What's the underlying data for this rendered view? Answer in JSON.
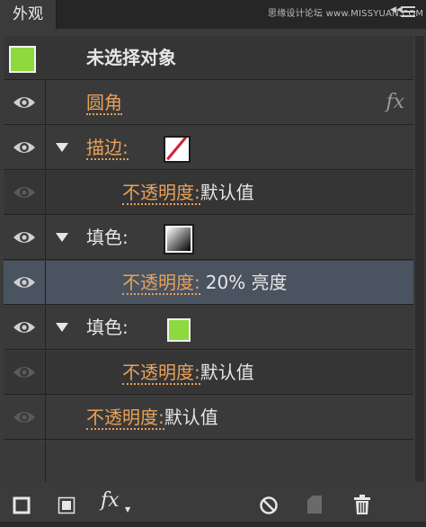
{
  "panel": {
    "tab_label": "外观",
    "watermark": "思缘设计论坛 www.MISSYUAN.COM",
    "header_title": "未选择对象",
    "fx_label": "fx"
  },
  "rows": [
    {
      "link": "圆角",
      "value": ""
    },
    {
      "link": "描边:",
      "value": ""
    },
    {
      "link": "不透明度:",
      "value": "默认值"
    },
    {
      "link": "",
      "value": "填色:"
    },
    {
      "link": "不透明度:",
      "value": "20% 亮度"
    },
    {
      "link": "",
      "value": "填色:"
    },
    {
      "link": "不透明度:",
      "value": "默认值"
    },
    {
      "link": "不透明度:",
      "value": "默认值"
    }
  ],
  "bottom": {
    "fx_label": "fx"
  },
  "colors": {
    "link": "#e8a15a",
    "fill_green": "#8ed93e",
    "stroke_red": "#d0203c",
    "selected_row": "#4a5360"
  },
  "icons": [
    "eye-icon",
    "fx-icon",
    "add-stroke-icon",
    "add-fill-icon",
    "fx-menu-icon",
    "clear-appearance-icon",
    "duplicate-item-icon",
    "delete-icon",
    "panel-menu-icon"
  ]
}
